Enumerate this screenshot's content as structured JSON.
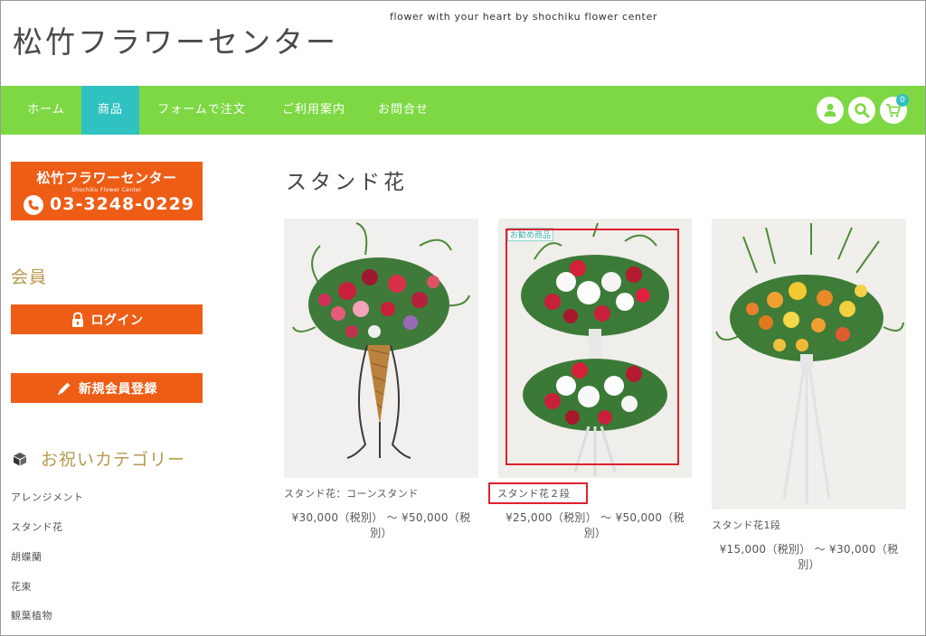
{
  "header": {
    "site_title": "松竹フラワーセンター",
    "tagline": "flower with your heart by shochiku flower center"
  },
  "nav": {
    "items": [
      {
        "label": "ホーム"
      },
      {
        "label": "商品",
        "active": true
      },
      {
        "label": "フォームで注文"
      },
      {
        "label": "ご利用案内"
      },
      {
        "label": "お問合せ"
      }
    ],
    "icons": [
      "user-icon",
      "search-icon",
      "cart-icon"
    ],
    "cart_count": "0"
  },
  "sidebar": {
    "banner": {
      "shop_name": "松竹フラワーセンター",
      "shop_name_roman": "Shochiku Flower Center",
      "phone": "03-3248-0229"
    },
    "member_heading": "会員",
    "login_label": "ログイン",
    "register_label": "新規会員登録",
    "category_heading": "お祝いカテゴリー",
    "categories": [
      "アレンジメント",
      "スタンド花",
      "胡蝶蘭",
      "花束",
      "観葉植物"
    ]
  },
  "main": {
    "title": "スタンド花",
    "ribbon": "お勧め商品",
    "products": [
      {
        "name": "スタンド花：コーンスタンド",
        "price_line1": "¥30,000（税別） 〜 ¥50,000（税",
        "price_line2": "別）"
      },
      {
        "name": "スタンド花２段",
        "price_line1": "¥25,000（税別） 〜 ¥50,000（税",
        "price_line2": "別）"
      },
      {
        "name": "スタンド花1段",
        "price_line1": "¥15,000（税別） 〜 ¥30,000（税",
        "price_line2": "別）"
      }
    ]
  },
  "colors": {
    "nav_green": "#7ed844",
    "nav_active": "#30c2c0",
    "orange": "#ee5d16",
    "heading_gold": "#b89a4e",
    "highlight_red": "#e0202f"
  }
}
